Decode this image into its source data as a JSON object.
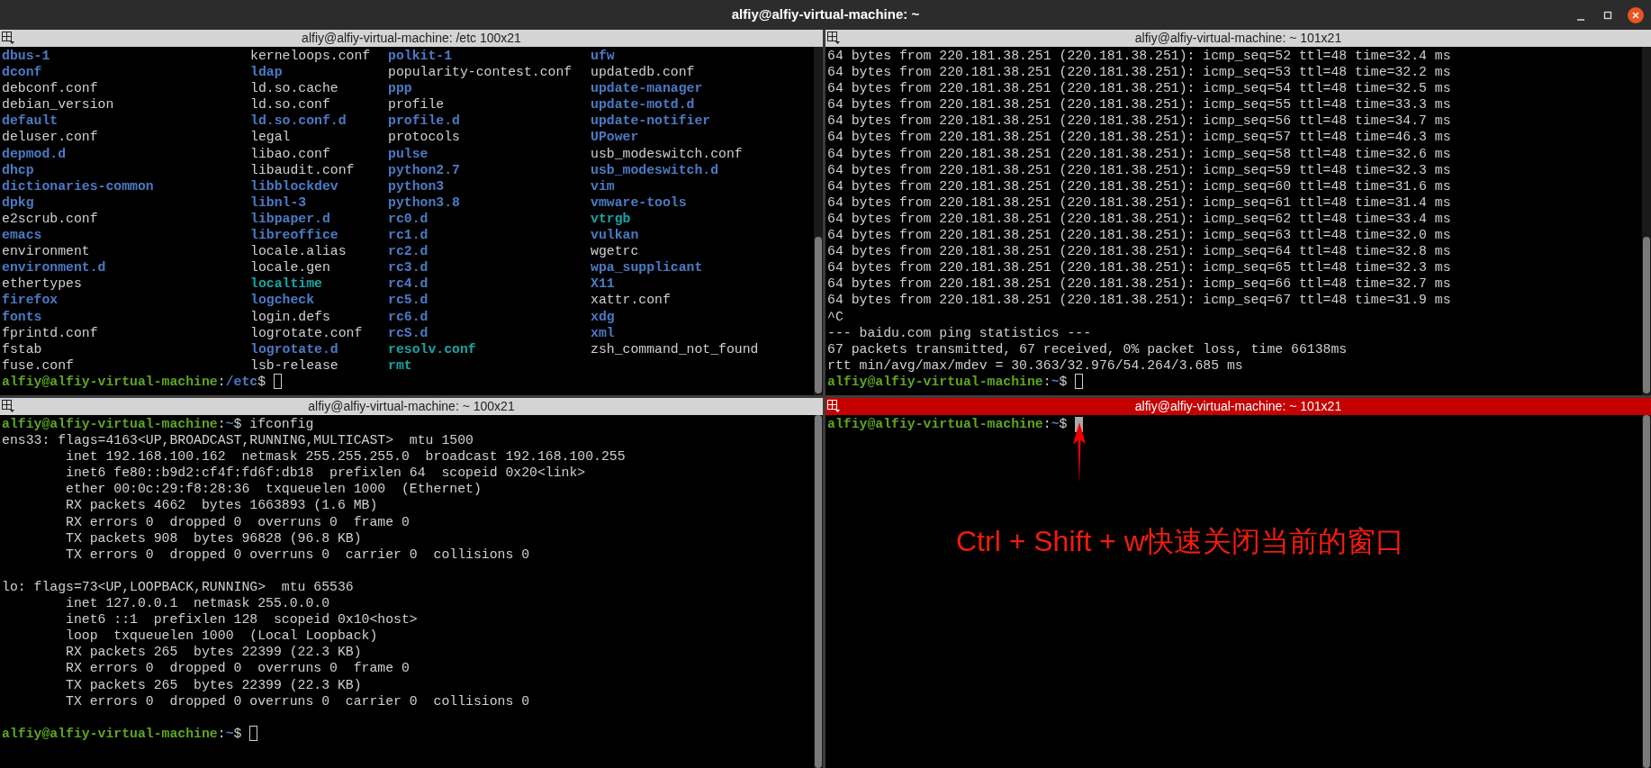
{
  "window": {
    "title": "alfiy@alfiy-virtual-machine: ~"
  },
  "panes": [
    {
      "title": "alfiy@alfiy-virtual-machine: /etc 100x21",
      "active": false,
      "content": [
        {
          "kind": "ls",
          "rows": [
            [
              {
                "name": "dbus-1",
                "kind": "dir"
              },
              {
                "name": "kerneloops.conf",
                "kind": "file"
              },
              {
                "name": "polkit-1",
                "kind": "dir"
              },
              {
                "name": "ufw",
                "kind": "dir"
              }
            ],
            [
              {
                "name": "dconf",
                "kind": "dir"
              },
              {
                "name": "ldap",
                "kind": "dir"
              },
              {
                "name": "popularity-contest.conf",
                "kind": "file"
              },
              {
                "name": "updatedb.conf",
                "kind": "file"
              }
            ],
            [
              {
                "name": "debconf.conf",
                "kind": "file"
              },
              {
                "name": "ld.so.cache",
                "kind": "file"
              },
              {
                "name": "ppp",
                "kind": "dir"
              },
              {
                "name": "update-manager",
                "kind": "dir"
              }
            ],
            [
              {
                "name": "debian_version",
                "kind": "file"
              },
              {
                "name": "ld.so.conf",
                "kind": "file"
              },
              {
                "name": "profile",
                "kind": "file"
              },
              {
                "name": "update-motd.d",
                "kind": "dir"
              }
            ],
            [
              {
                "name": "default",
                "kind": "dir"
              },
              {
                "name": "ld.so.conf.d",
                "kind": "dir"
              },
              {
                "name": "profile.d",
                "kind": "dir"
              },
              {
                "name": "update-notifier",
                "kind": "dir"
              }
            ],
            [
              {
                "name": "deluser.conf",
                "kind": "file"
              },
              {
                "name": "legal",
                "kind": "file"
              },
              {
                "name": "protocols",
                "kind": "file"
              },
              {
                "name": "UPower",
                "kind": "dir"
              }
            ],
            [
              {
                "name": "depmod.d",
                "kind": "dir"
              },
              {
                "name": "libao.conf",
                "kind": "file"
              },
              {
                "name": "pulse",
                "kind": "dir"
              },
              {
                "name": "usb_modeswitch.conf",
                "kind": "file"
              }
            ],
            [
              {
                "name": "dhcp",
                "kind": "dir"
              },
              {
                "name": "libaudit.conf",
                "kind": "file"
              },
              {
                "name": "python2.7",
                "kind": "dir"
              },
              {
                "name": "usb_modeswitch.d",
                "kind": "dir"
              }
            ],
            [
              {
                "name": "dictionaries-common",
                "kind": "dir"
              },
              {
                "name": "libblockdev",
                "kind": "dir"
              },
              {
                "name": "python3",
                "kind": "dir"
              },
              {
                "name": "vim",
                "kind": "dir"
              }
            ],
            [
              {
                "name": "dpkg",
                "kind": "dir"
              },
              {
                "name": "libnl-3",
                "kind": "dir"
              },
              {
                "name": "python3.8",
                "kind": "dir"
              },
              {
                "name": "vmware-tools",
                "kind": "dir"
              }
            ],
            [
              {
                "name": "e2scrub.conf",
                "kind": "file"
              },
              {
                "name": "libpaper.d",
                "kind": "dir"
              },
              {
                "name": "rc0.d",
                "kind": "dir"
              },
              {
                "name": "vtrgb",
                "kind": "link"
              }
            ],
            [
              {
                "name": "emacs",
                "kind": "dir"
              },
              {
                "name": "libreoffice",
                "kind": "dir"
              },
              {
                "name": "rc1.d",
                "kind": "dir"
              },
              {
                "name": "vulkan",
                "kind": "dir"
              }
            ],
            [
              {
                "name": "environment",
                "kind": "file"
              },
              {
                "name": "locale.alias",
                "kind": "file"
              },
              {
                "name": "rc2.d",
                "kind": "dir"
              },
              {
                "name": "wgetrc",
                "kind": "file"
              }
            ],
            [
              {
                "name": "environment.d",
                "kind": "dir"
              },
              {
                "name": "locale.gen",
                "kind": "file"
              },
              {
                "name": "rc3.d",
                "kind": "dir"
              },
              {
                "name": "wpa_supplicant",
                "kind": "dir"
              }
            ],
            [
              {
                "name": "ethertypes",
                "kind": "file"
              },
              {
                "name": "localtime",
                "kind": "link"
              },
              {
                "name": "rc4.d",
                "kind": "dir"
              },
              {
                "name": "X11",
                "kind": "dir"
              }
            ],
            [
              {
                "name": "firefox",
                "kind": "dir"
              },
              {
                "name": "logcheck",
                "kind": "dir"
              },
              {
                "name": "rc5.d",
                "kind": "dir"
              },
              {
                "name": "xattr.conf",
                "kind": "file"
              }
            ],
            [
              {
                "name": "fonts",
                "kind": "dir"
              },
              {
                "name": "login.defs",
                "kind": "file"
              },
              {
                "name": "rc6.d",
                "kind": "dir"
              },
              {
                "name": "xdg",
                "kind": "dir"
              }
            ],
            [
              {
                "name": "fprintd.conf",
                "kind": "file"
              },
              {
                "name": "logrotate.conf",
                "kind": "file"
              },
              {
                "name": "rcS.d",
                "kind": "dir"
              },
              {
                "name": "xml",
                "kind": "dir"
              }
            ],
            [
              {
                "name": "fstab",
                "kind": "file"
              },
              {
                "name": "logrotate.d",
                "kind": "dir"
              },
              {
                "name": "resolv.conf",
                "kind": "link"
              },
              {
                "name": "zsh_command_not_found",
                "kind": "file"
              }
            ],
            [
              {
                "name": "fuse.conf",
                "kind": "file"
              },
              {
                "name": "lsb-release",
                "kind": "file"
              },
              {
                "name": "rmt",
                "kind": "link"
              }
            ]
          ]
        },
        {
          "kind": "prompt",
          "user_host": "alfiy@alfiy-virtual-machine",
          "separator": ":",
          "path": "/etc",
          "symbol": "$",
          "cursor": true
        }
      ]
    },
    {
      "title": "alfiy@alfiy-virtual-machine: ~ 101x21",
      "active": false,
      "content": [
        {
          "kind": "output",
          "blank_after": false,
          "lines": [
            "64 bytes from 220.181.38.251 (220.181.38.251): icmp_seq=52 ttl=48 time=32.4 ms",
            "64 bytes from 220.181.38.251 (220.181.38.251): icmp_seq=53 ttl=48 time=32.2 ms",
            "64 bytes from 220.181.38.251 (220.181.38.251): icmp_seq=54 ttl=48 time=32.5 ms",
            "64 bytes from 220.181.38.251 (220.181.38.251): icmp_seq=55 ttl=48 time=33.3 ms",
            "64 bytes from 220.181.38.251 (220.181.38.251): icmp_seq=56 ttl=48 time=34.7 ms",
            "64 bytes from 220.181.38.251 (220.181.38.251): icmp_seq=57 ttl=48 time=46.3 ms",
            "64 bytes from 220.181.38.251 (220.181.38.251): icmp_seq=58 ttl=48 time=32.6 ms",
            "64 bytes from 220.181.38.251 (220.181.38.251): icmp_seq=59 ttl=48 time=32.3 ms",
            "64 bytes from 220.181.38.251 (220.181.38.251): icmp_seq=60 ttl=48 time=31.6 ms",
            "64 bytes from 220.181.38.251 (220.181.38.251): icmp_seq=61 ttl=48 time=31.4 ms",
            "64 bytes from 220.181.38.251 (220.181.38.251): icmp_seq=62 ttl=48 time=33.4 ms",
            "64 bytes from 220.181.38.251 (220.181.38.251): icmp_seq=63 ttl=48 time=32.0 ms",
            "64 bytes from 220.181.38.251 (220.181.38.251): icmp_seq=64 ttl=48 time=32.8 ms",
            "64 bytes from 220.181.38.251 (220.181.38.251): icmp_seq=65 ttl=48 time=32.3 ms",
            "64 bytes from 220.181.38.251 (220.181.38.251): icmp_seq=66 ttl=48 time=32.7 ms",
            "64 bytes from 220.181.38.251 (220.181.38.251): icmp_seq=67 ttl=48 time=31.9 ms",
            "^C",
            "--- baidu.com ping statistics ---",
            "67 packets transmitted, 67 received, 0% packet loss, time 66138ms",
            "rtt min/avg/max/mdev = 30.363/32.976/54.264/3.685 ms"
          ]
        },
        {
          "kind": "prompt",
          "user_host": "alfiy@alfiy-virtual-machine",
          "separator": ":",
          "path": "~",
          "symbol": "$",
          "cursor": true
        }
      ]
    },
    {
      "title": "alfiy@alfiy-virtual-machine: ~ 100x21",
      "active": false,
      "content": [
        {
          "kind": "prompt",
          "user_host": "alfiy@alfiy-virtual-machine",
          "separator": ":",
          "path": "~",
          "symbol": "$",
          "command": "ifconfig",
          "cursor": false
        },
        {
          "kind": "output",
          "blank_after": true,
          "lines": [
            "ens33: flags=4163<UP,BROADCAST,RUNNING,MULTICAST>  mtu 1500",
            "        inet 192.168.100.162  netmask 255.255.255.0  broadcast 192.168.100.255",
            "        inet6 fe80::b9d2:cf4f:fd6f:db18  prefixlen 64  scopeid 0x20<link>",
            "        ether 00:0c:29:f8:28:36  txqueuelen 1000  (Ethernet)",
            "        RX packets 4662  bytes 1663893 (1.6 MB)",
            "        RX errors 0  dropped 0  overruns 0  frame 0",
            "        TX packets 908  bytes 96828 (96.8 KB)",
            "        TX errors 0  dropped 0 overruns 0  carrier 0  collisions 0"
          ]
        },
        {
          "kind": "output",
          "blank_after": true,
          "lines": [
            "lo: flags=73<UP,LOOPBACK,RUNNING>  mtu 65536",
            "        inet 127.0.0.1  netmask 255.0.0.0",
            "        inet6 ::1  prefixlen 128  scopeid 0x10<host>",
            "        loop  txqueuelen 1000  (Local Loopback)",
            "        RX packets 265  bytes 22399 (22.3 KB)",
            "        RX errors 0  dropped 0  overruns 0  frame 0",
            "        TX packets 265  bytes 22399 (22.3 KB)",
            "        TX errors 0  dropped 0 overruns 0  carrier 0  collisions 0"
          ]
        },
        {
          "kind": "prompt",
          "user_host": "alfiy@alfiy-virtual-machine",
          "separator": ":",
          "path": "~",
          "symbol": "$",
          "cursor": true
        }
      ]
    },
    {
      "title": "alfiy@alfiy-virtual-machine: ~ 101x21",
      "active": true,
      "content": [
        {
          "kind": "prompt",
          "user_host": "alfiy@alfiy-virtual-machine",
          "separator": ":",
          "path": "~",
          "symbol": "$",
          "cursor": true
        }
      ],
      "annotation": {
        "text": "Ctrl + Shift + w快速关闭当前的窗口"
      }
    }
  ]
}
